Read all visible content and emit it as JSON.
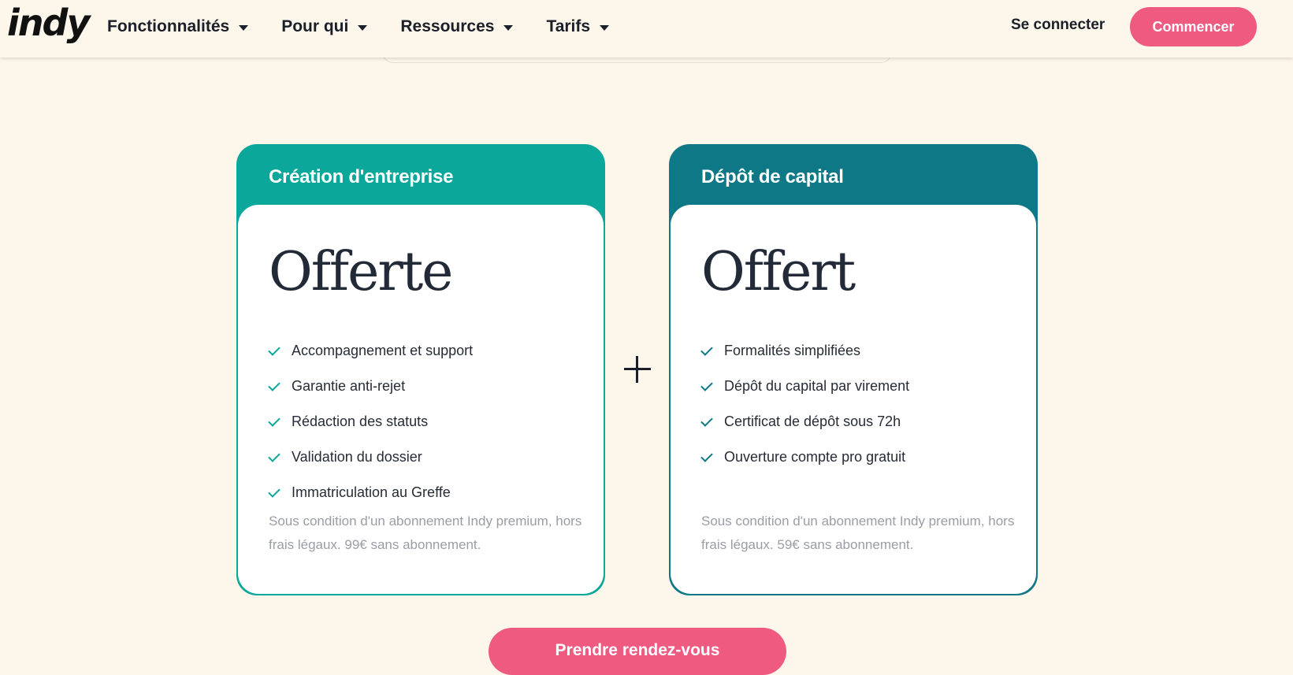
{
  "header": {
    "logo": "indy",
    "nav": [
      {
        "label": "Fonctionnalités"
      },
      {
        "label": "Pour qui"
      },
      {
        "label": "Ressources"
      },
      {
        "label": "Tarifs"
      }
    ],
    "login_label": "Se connecter",
    "start_label": "Commencer"
  },
  "cards": [
    {
      "title": "Création d'entreprise",
      "price": "Offerte",
      "features": [
        "Accompagnement et support",
        "Garantie anti-rejet",
        "Rédaction des statuts",
        "Validation du dossier",
        "Immatriculation au Greffe"
      ],
      "note": "Sous condition d'un abonnement Indy premium, hors frais légaux. 99€ sans abonnement."
    },
    {
      "title": "Dépôt de capital",
      "price": "Offert",
      "features": [
        "Formalités simplifiées",
        "Dépôt du capital par virement",
        "Certificat de dépôt sous 72h",
        "Ouverture compte pro gratuit"
      ],
      "note": "Sous condition d'un abonnement Indy premium, hors frais légaux. 59€ sans abonnement."
    }
  ],
  "cta_label": "Prendre rendez-vous",
  "colors": {
    "background": "#fdf6ea",
    "accent_pink": "#ef5a80",
    "card1_teal": "#0ba79a",
    "card2_teal": "#0e7887"
  }
}
